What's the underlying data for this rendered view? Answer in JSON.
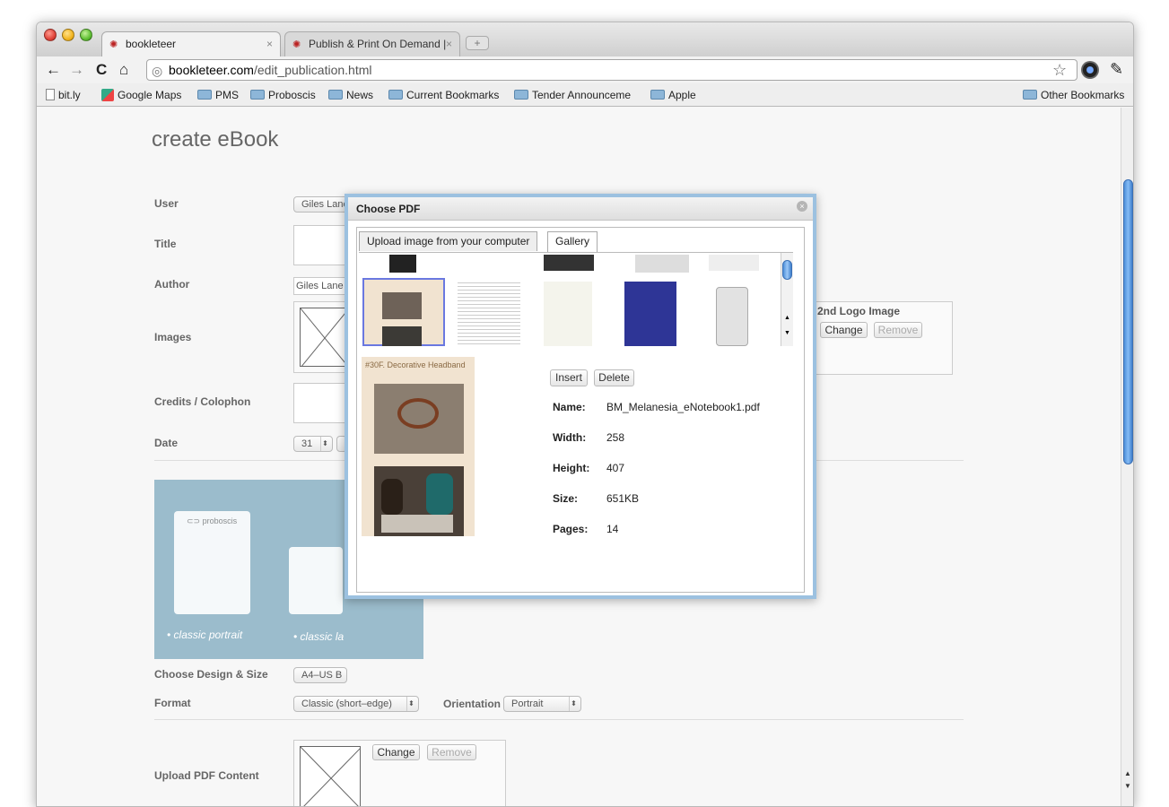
{
  "browser": {
    "tabs": [
      {
        "label": "bookleteer",
        "close": "×"
      },
      {
        "label": "Publish & Print On Demand |",
        "close": "×"
      }
    ],
    "new_tab": "+",
    "nav": {
      "back": "←",
      "forward": "→",
      "reload": "C",
      "home": "⌂"
    },
    "url_host": "bookleteer.com",
    "url_path": "/edit_publication.html",
    "star": "☆",
    "wrench": "🔧",
    "bookmarks": [
      {
        "label": "bit.ly",
        "icon": "page-icon"
      },
      {
        "label": "Google Maps",
        "icon": "google-maps-icon"
      },
      {
        "label": "PMS",
        "icon": "folder-icon"
      },
      {
        "label": "Proboscis",
        "icon": "folder-icon"
      },
      {
        "label": "News",
        "icon": "folder-icon"
      },
      {
        "label": "Current Bookmarks",
        "icon": "folder-icon"
      },
      {
        "label": "Tender Announceme",
        "icon": "folder-icon"
      },
      {
        "label": "Apple",
        "icon": "folder-icon"
      }
    ],
    "other_bookmarks": "Other Bookmarks"
  },
  "form": {
    "page_title": "create eBook",
    "labels": {
      "user": "User",
      "title": "Title",
      "author": "Author",
      "images": "Images",
      "credits": "Credits / Colophon",
      "date": "Date",
      "design_size": "Choose Design & Size",
      "format": "Format",
      "orientation": "Orientation",
      "upload_pdf": "Upload PDF Content",
      "logo2": "2nd Logo Image"
    },
    "user_value": "Giles Lane",
    "author_value": "Giles Lane",
    "date_day": "31",
    "design_size_value": "A4–US B",
    "format_value": "Classic (short–edge)",
    "orientation_value": "Portrait",
    "change_label": "Change",
    "remove_label": "Remove",
    "design_options": [
      {
        "label": "• classic portrait",
        "brand": "⊂⊃ proboscis"
      },
      {
        "label": "• classic la"
      }
    ]
  },
  "modal": {
    "title": "Choose PDF",
    "close": "×",
    "tabs": [
      "Upload image from your computer",
      "Gallery"
    ],
    "insert_label": "Insert",
    "delete_label": "Delete",
    "preview_caption": "#30F. Decorative Headband",
    "info": [
      {
        "key": "Name:",
        "value": "BM_Melanesia_eNotebook1.pdf"
      },
      {
        "key": "Width:",
        "value": "258"
      },
      {
        "key": "Height:",
        "value": "407"
      },
      {
        "key": "Size:",
        "value": "651KB"
      },
      {
        "key": "Pages:",
        "value": "14"
      }
    ]
  },
  "colors": {
    "accent": "#9bbccc",
    "modal_border": "#9cc1e0",
    "selection": "#6a78e0"
  }
}
